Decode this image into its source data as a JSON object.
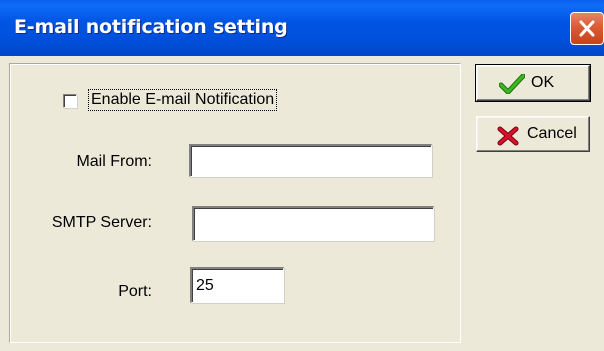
{
  "window": {
    "title": "E-mail notification setting"
  },
  "form": {
    "enable_checkbox": {
      "label": "Enable E-mail Notification",
      "checked": false
    },
    "mail_from": {
      "label": "Mail From:",
      "value": ""
    },
    "smtp_server": {
      "label": "SMTP Server:",
      "value": ""
    },
    "port": {
      "label": "Port:",
      "value": "25"
    }
  },
  "buttons": {
    "ok_label": "OK",
    "cancel_label": "Cancel"
  },
  "icons": {
    "close": "close-icon",
    "ok": "checkmark-icon",
    "cancel": "x-icon"
  },
  "colors": {
    "titlebar": "#0054e3",
    "close_button": "#d95b34",
    "dialog_bg": "#ece9d8",
    "ok_check": "#2e9a16",
    "cancel_x": "#c8001e"
  }
}
